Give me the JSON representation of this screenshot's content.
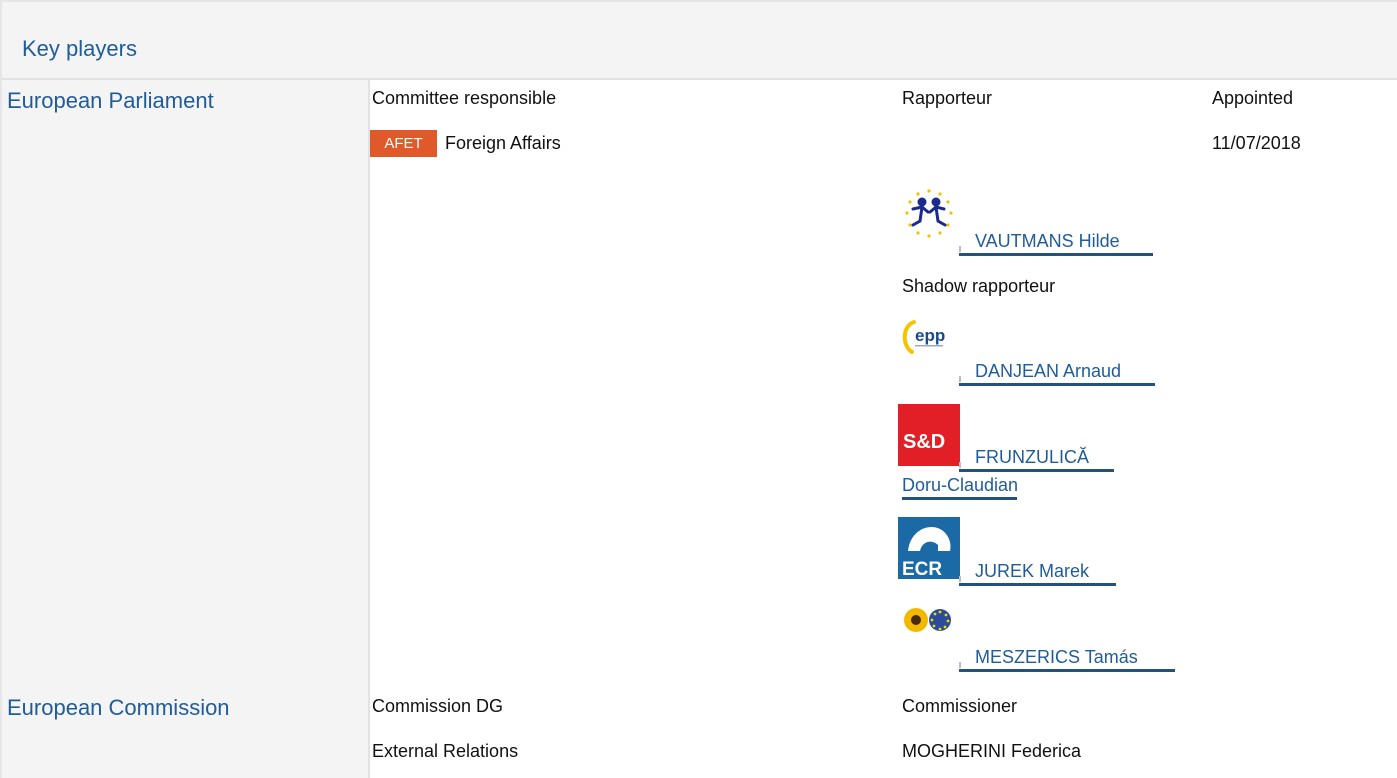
{
  "header": {
    "title": "Key players"
  },
  "parliament": {
    "title": "European Parliament",
    "committee_header": "Committee responsible",
    "rapporteur_header": "Rapporteur",
    "appointed_header": "Appointed",
    "committee_badge": "AFET",
    "committee_name": "Foreign Affairs",
    "appointed_date": "11/07/2018",
    "rapporteur": {
      "name": "VAUTMANS Hilde",
      "group_logo": "renew-europe-logo"
    },
    "shadow_header": "Shadow rapporteur",
    "shadows": [
      {
        "name": "DANJEAN Arnaud",
        "group_logo": "epp-logo"
      },
      {
        "name_line1": "FRUNZULICĂ",
        "name_line2": "Doru-Claudian",
        "group_logo": "sd-logo"
      },
      {
        "name": "JUREK Marek",
        "group_logo": "ecr-logo"
      },
      {
        "name": "MESZERICS Tamás",
        "group_logo": "greens-efa-logo"
      }
    ]
  },
  "commission": {
    "title": "European Commission",
    "dg_header": "Commission DG",
    "commissioner_header": "Commissioner",
    "dg_name": "External Relations",
    "commissioner_name": "MOGHERINI Federica"
  },
  "colors": {
    "accent": "#1f5c99",
    "badge": "#e0592a",
    "sd_red": "#e21f26",
    "ecr_blue": "#1b6aa5",
    "link_underline": "#24527f"
  }
}
